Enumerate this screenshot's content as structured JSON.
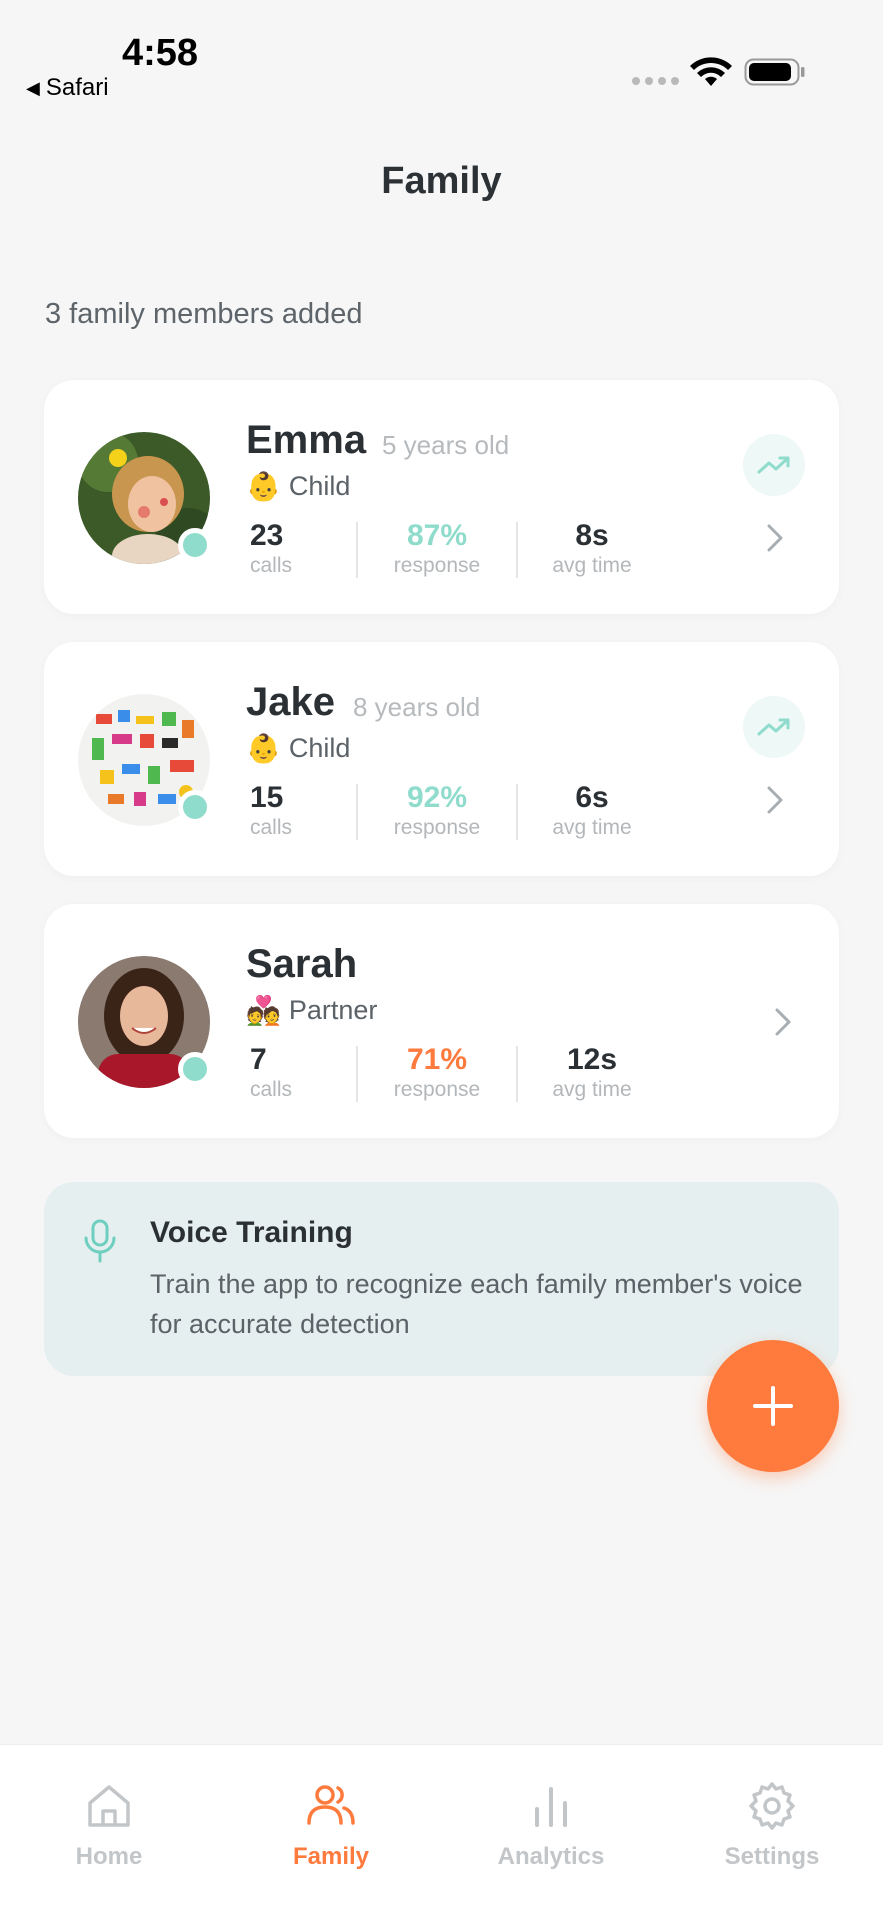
{
  "status_bar": {
    "time": "4:58",
    "back_app": "Safari"
  },
  "header": {
    "title": "Family"
  },
  "subtitle": "3 family members added",
  "members": [
    {
      "name": "Emma",
      "age": "5 years old",
      "role_emoji": "👶",
      "role": "Child",
      "calls": "23",
      "calls_label": "calls",
      "response": "87%",
      "response_label": "response",
      "avg_time": "8s",
      "avg_time_label": "avg time",
      "response_color": "teal",
      "trend": true
    },
    {
      "name": "Jake",
      "age": "8 years old",
      "role_emoji": "👶",
      "role": "Child",
      "calls": "15",
      "calls_label": "calls",
      "response": "92%",
      "response_label": "response",
      "avg_time": "6s",
      "avg_time_label": "avg time",
      "response_color": "teal",
      "trend": true
    },
    {
      "name": "Sarah",
      "age": "",
      "role_emoji": "💑",
      "role": "Partner",
      "calls": "7",
      "calls_label": "calls",
      "response": "71%",
      "response_label": "response",
      "avg_time": "12s",
      "avg_time_label": "avg time",
      "response_color": "orange",
      "trend": false
    }
  ],
  "voice_training": {
    "title": "Voice Training",
    "description": "Train the app to recognize each family member's voice for accurate detection"
  },
  "tabs": [
    {
      "label": "Home",
      "icon": "home-icon",
      "active": false
    },
    {
      "label": "Family",
      "icon": "users-icon",
      "active": true
    },
    {
      "label": "Analytics",
      "icon": "bar-chart-icon",
      "active": false
    },
    {
      "label": "Settings",
      "icon": "gear-icon",
      "active": false
    }
  ],
  "colors": {
    "accent": "#ff7a3d",
    "teal": "#8fdccc",
    "background": "#f6f6f6"
  }
}
